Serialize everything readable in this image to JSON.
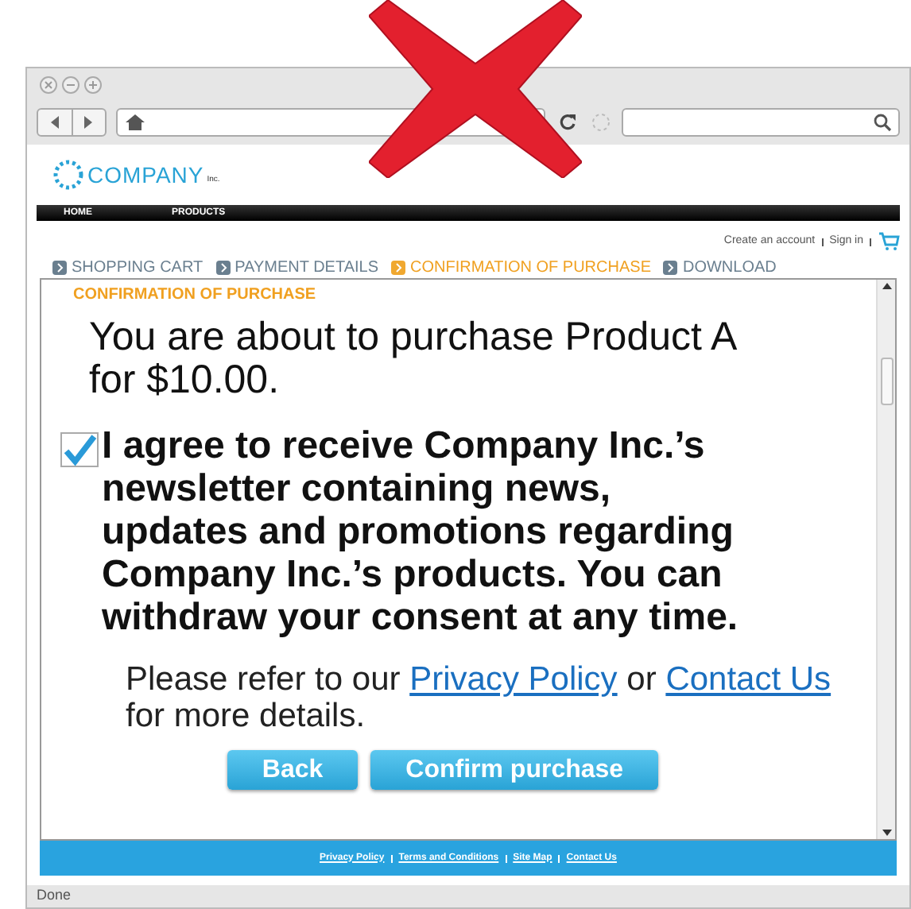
{
  "browser": {
    "status": "Done"
  },
  "site": {
    "logo_name": "COMPANY",
    "logo_suffix": "Inc.",
    "nav": [
      "HOME",
      "PRODUCTS"
    ],
    "account_links": [
      "Create an account",
      "Sign in"
    ],
    "steps": [
      {
        "label": "SHOPPING CART",
        "selected": false
      },
      {
        "label": "PAYMENT DETAILS",
        "selected": false
      },
      {
        "label": "CONFIRMATION OF PURCHASE",
        "selected": true
      },
      {
        "label": "DOWNLOAD",
        "selected": false
      }
    ],
    "panel": {
      "heading": "CONFIRMATION OF PURCHASE",
      "summary": "You are about to purchase Product A for $10.00.",
      "consent": {
        "checked": true,
        "text": "I agree to receive Company Inc.’s newsletter containing news, updates and promotions regarding Company Inc.’s products. You can withdraw your consent at any time."
      },
      "refer": {
        "before": "Please refer to our",
        "link_1": "Privacy Policy",
        "middle": "or",
        "link_2": "Contact Us",
        "after": "for more details."
      },
      "buttons": [
        "Back",
        "Confirm purchase"
      ]
    },
    "footer_links": [
      "Privacy Policy",
      "Terms and Conditions",
      "Site Map",
      "Contact Us"
    ]
  }
}
